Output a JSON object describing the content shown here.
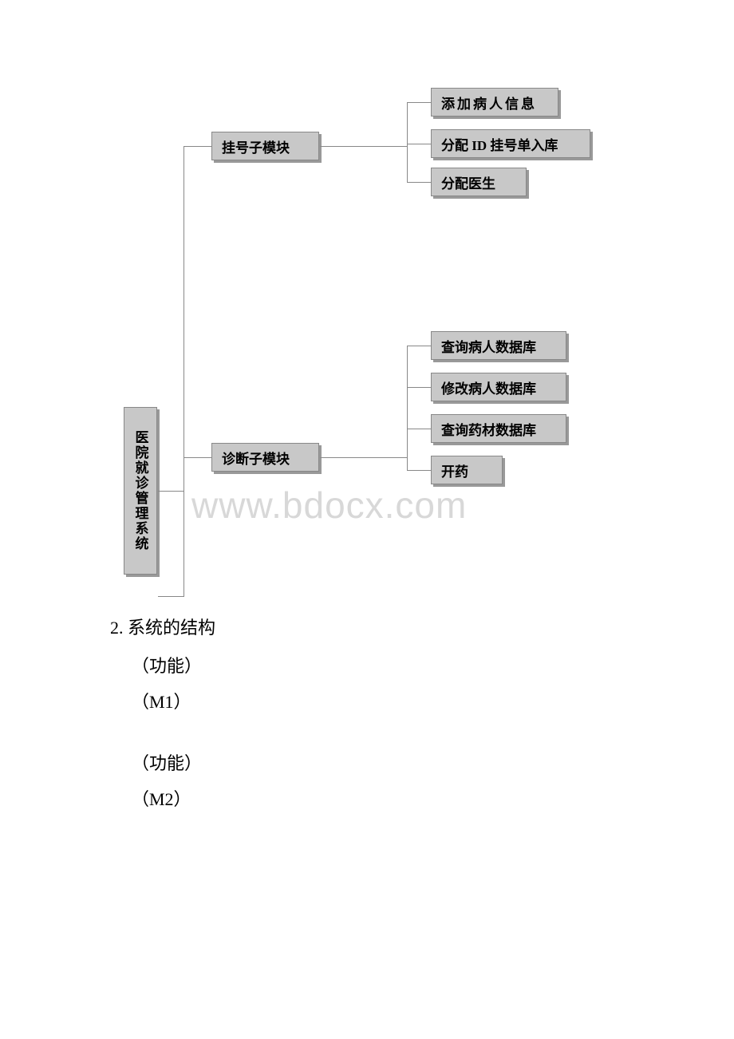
{
  "diagram": {
    "root": "医院就诊管理系统",
    "module1": "挂号子模块",
    "module1_children": {
      "c1": "添加病人信息",
      "c2": "分配 ID 挂号单入库",
      "c3": "分配医生"
    },
    "module2": "诊断子模块",
    "module2_children": {
      "c1": "查询病人数据库",
      "c2": "修改病人数据库",
      "c3": "查询药材数据库",
      "c4": "开药"
    }
  },
  "text": {
    "section_title": "2. 系统的结构",
    "line1": "（功能）",
    "line2": "（M1）",
    "line3": "（功能）",
    "line4": "（M2）"
  },
  "watermark": "www.bdocx.com"
}
